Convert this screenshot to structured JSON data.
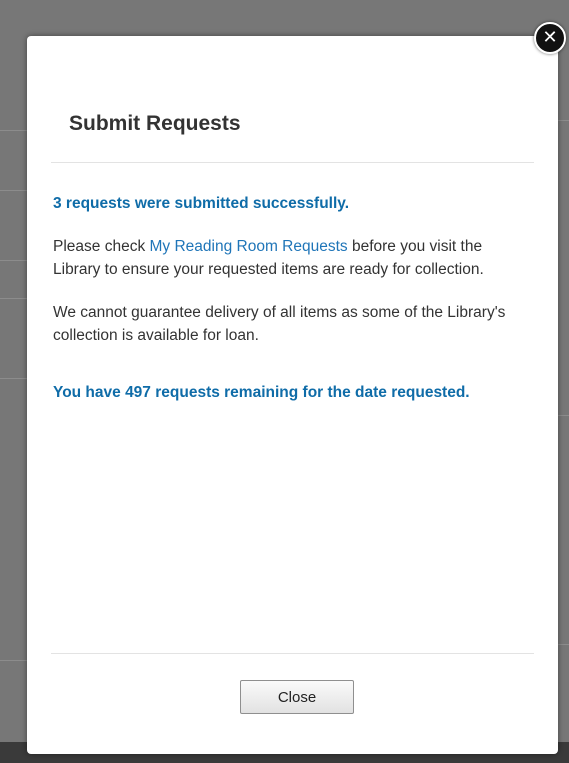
{
  "dialog": {
    "title": "Submit Requests",
    "close_icon": "close-icon",
    "close_glyph": "✕",
    "success_message": "3 requests were submitted successfully.",
    "check_prefix": "Please check ",
    "check_link": "My Reading Room Requests",
    "check_suffix": " before you visit the Library to ensure your requested items are ready for collection.",
    "guarantee_text": "We cannot guarantee delivery of all items as some of the Library's collection is available for loan.",
    "remaining_message": "You have 497 requests remaining for the date requested.",
    "close_button_label": "Close"
  },
  "colors": {
    "accent": "#0f6ca8",
    "link": "#1f75b8",
    "text": "#333333",
    "overlay": "#777777"
  }
}
